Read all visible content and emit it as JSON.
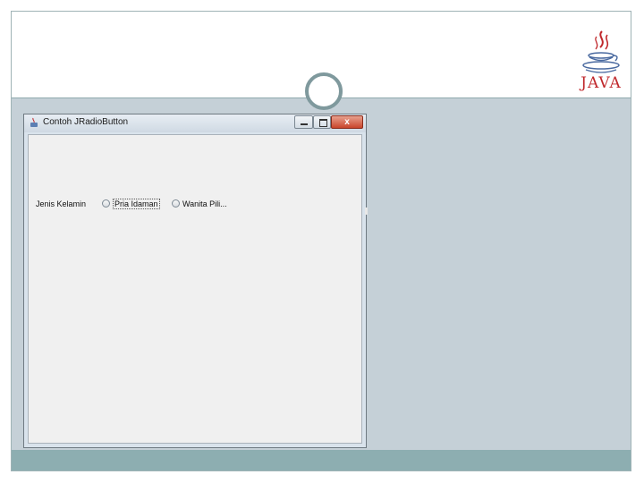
{
  "slide": {
    "logo_text": "JAVA"
  },
  "window": {
    "title": "Contoh JRadioButton",
    "close_glyph": "x",
    "form": {
      "label": "Jenis Kelamin",
      "options": [
        {
          "label": "Pria Idaman",
          "selected": false,
          "focused": true
        },
        {
          "label": "Wanita Pili...",
          "selected": false,
          "focused": false
        }
      ]
    }
  },
  "colors": {
    "body": "#c5d0d7",
    "footer": "#8daeb1",
    "accent_ring": "#7f999d",
    "java_red": "#c0282c"
  }
}
